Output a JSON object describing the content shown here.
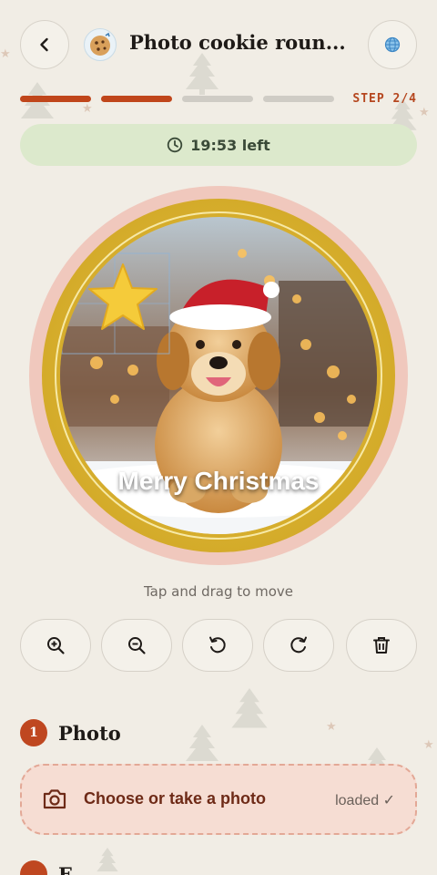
{
  "header": {
    "title": "Photo cookie roun...",
    "back_icon": "chevron-left-icon",
    "logo_icon": "cookie-icon",
    "language_icon": "globe-icon"
  },
  "progress": {
    "step_label": "STEP 2/4",
    "current_step": 2,
    "total_steps": 4,
    "accent_color": "#c0461b"
  },
  "timer": {
    "icon": "clock-icon",
    "text": "19:53 left",
    "background_color": "#dce9cc"
  },
  "cookie": {
    "caption": "Merry Christmas",
    "sticker_icon": "star-icon",
    "ring_color": "#d4ab2a",
    "outer_color": "#f0c8bd"
  },
  "hint": "Tap and drag to move",
  "tools": [
    {
      "icon": "zoom-in-icon"
    },
    {
      "icon": "zoom-out-icon"
    },
    {
      "icon": "rotate-left-icon"
    },
    {
      "icon": "rotate-right-icon"
    },
    {
      "icon": "trash-icon"
    }
  ],
  "section_photo": {
    "number": "1",
    "title": "Photo",
    "choose_label": "Choose or take a photo",
    "status": "loaded ✓",
    "camera_icon": "camera-icon"
  },
  "section_next": {
    "title": "F"
  }
}
